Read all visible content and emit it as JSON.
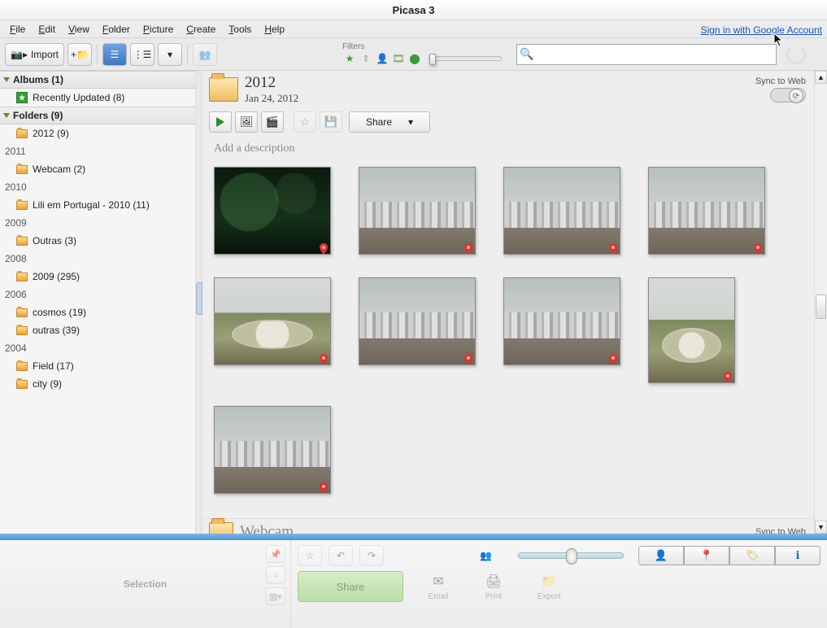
{
  "app": {
    "title": "Picasa 3"
  },
  "menu": [
    "File",
    "Edit",
    "View",
    "Folder",
    "Picture",
    "Create",
    "Tools",
    "Help"
  ],
  "signin": "Sign in with Google Account",
  "toolbar": {
    "import_label": "Import",
    "filters_label": "Filters",
    "search_placeholder": ""
  },
  "sidebar": {
    "albums_header": "Albums (1)",
    "recently_updated": "Recently Updated (8)",
    "folders_header": "Folders (9)",
    "groups": [
      {
        "year": "",
        "items": [
          {
            "label": "2012 (9)"
          }
        ]
      },
      {
        "year": "2011",
        "items": [
          {
            "label": "Webcam (2)"
          }
        ]
      },
      {
        "year": "2010",
        "items": [
          {
            "label": "Lili em Portugal - 2010 (11)"
          }
        ]
      },
      {
        "year": "2009",
        "items": [
          {
            "label": "Outras (3)"
          }
        ]
      },
      {
        "year": "2008",
        "items": [
          {
            "label": "2009 (295)"
          }
        ]
      },
      {
        "year": "2006",
        "items": [
          {
            "label": "cosmos (19)"
          },
          {
            "label": "outras (39)"
          }
        ]
      },
      {
        "year": "2004",
        "items": [
          {
            "label": "Field (17)"
          },
          {
            "label": "city (9)"
          }
        ]
      }
    ]
  },
  "folder": {
    "title": "2012",
    "date": "Jan 24, 2012",
    "sync_label": "Sync to Web",
    "share_label": "Share",
    "description_placeholder": "Add a description",
    "next_title": "Webcam",
    "thumbs": [
      {
        "kind": "night",
        "geo": true
      },
      {
        "kind": "city",
        "geo": true
      },
      {
        "kind": "city",
        "geo": true
      },
      {
        "kind": "city",
        "geo": true
      },
      {
        "kind": "plaza",
        "geo": true
      },
      {
        "kind": "city",
        "geo": true
      },
      {
        "kind": "city",
        "geo": true
      },
      {
        "kind": "plaza",
        "geo": true,
        "tall": true
      },
      {
        "kind": "city",
        "geo": true
      }
    ]
  },
  "bottom": {
    "selection_label": "Selection",
    "share_label": "Share",
    "actions": [
      "Email",
      "Print",
      "Export"
    ]
  }
}
